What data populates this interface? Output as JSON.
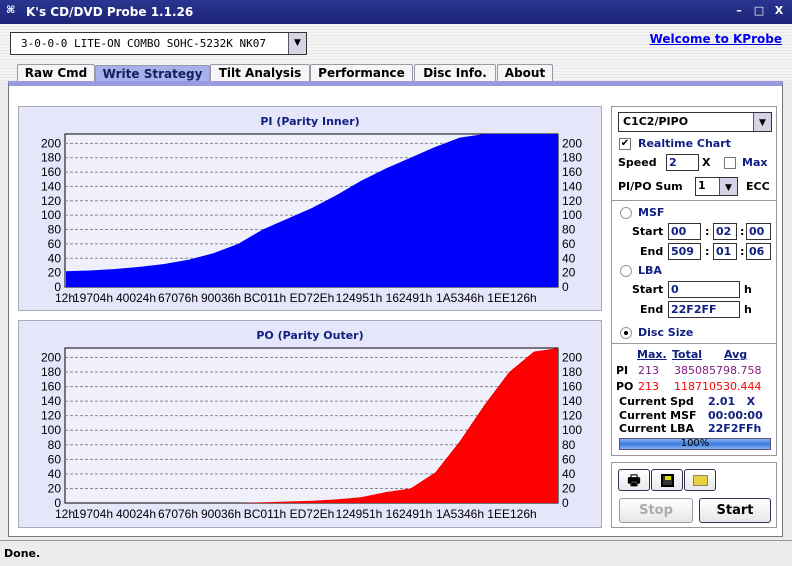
{
  "window": {
    "title": "K's CD/DVD Probe 1.1.26",
    "minimize": "–",
    "maximize": "□",
    "close": "X"
  },
  "drive": {
    "selected": "3-0-0-0 LITE-ON COMBO SOHC-5232K NK07"
  },
  "welcome_link": "Welcome to KProbe",
  "tabs": [
    {
      "label": "Raw Cmd"
    },
    {
      "label": "Write Strategy"
    },
    {
      "label": "Tilt Analysis"
    },
    {
      "label": "Performance"
    },
    {
      "label": "Disc Info."
    },
    {
      "label": "About"
    }
  ],
  "active_tab": "Write Strategy",
  "controls": {
    "mode": "C1C2/PIPO",
    "realtime_label": "Realtime Chart",
    "realtime_checked": true,
    "speed_label": "Speed",
    "speed_value": "2",
    "speed_unit": "X",
    "max_label": "Max",
    "max_checked": false,
    "sum_label": "PI/PO Sum",
    "sum_value": "1",
    "ecc_label": "ECC",
    "msf_label": "MSF",
    "start_label": "Start",
    "end_label": "End",
    "msf_start": [
      "00",
      "02",
      "00"
    ],
    "msf_end": [
      "509",
      "01",
      "06"
    ],
    "colon": ":",
    "lba_label": "LBA",
    "lba_start": "0",
    "lba_end": "22F2FF",
    "h": "h",
    "disc_size_label": "Disc Size",
    "range_mode": "Disc Size"
  },
  "stats": {
    "headers": {
      "max": "Max.",
      "total": "Total",
      "avg": "Avg"
    },
    "pi": {
      "label": "PI",
      "max": "213",
      "total": "38508579",
      "avg": "8.758"
    },
    "po": {
      "label": "PO",
      "max": "213",
      "total": "11871053",
      "avg": "0.444"
    },
    "current_spd_label": "Current Spd",
    "current_spd": "2.01   X",
    "current_msf_label": "Current MSF",
    "current_msf": "00:00:00",
    "current_lba_label": "Current LBA",
    "current_lba": "22F2FFh",
    "progress": 100,
    "progress_text": "100%"
  },
  "buttons": {
    "print": "printer-icon",
    "save": "floppy-disk-icon",
    "open": "folder-icon",
    "stop": "Stop",
    "start": "Start"
  },
  "status": "Done.",
  "colors": {
    "pi": "#0000ff",
    "po": "#ff0000",
    "titlebar": "#1b2476",
    "accent": "#102080"
  },
  "chart_data": [
    {
      "type": "bar",
      "title": "PI (Parity Inner)",
      "ylim": [
        0,
        213
      ],
      "yticks": [
        0,
        20,
        40,
        60,
        80,
        100,
        120,
        140,
        160,
        180,
        200
      ],
      "grid": true,
      "xticks": [
        "12h",
        "19704h",
        "40024h",
        "67076h",
        "90036h",
        "BC011h",
        "ED72Eh",
        "124951h",
        "162491h",
        "1A5346h",
        "1EE126h"
      ],
      "x_fraction": [
        0,
        0.05,
        0.1,
        0.15,
        0.2,
        0.25,
        0.3,
        0.35,
        0.4,
        0.45,
        0.5,
        0.55,
        0.6,
        0.65,
        0.7,
        0.75,
        0.8,
        0.85,
        0.9,
        0.95,
        1
      ],
      "values": [
        22,
        23,
        25,
        28,
        32,
        38,
        47,
        60,
        80,
        95,
        110,
        128,
        148,
        165,
        180,
        195,
        208,
        213,
        213,
        213,
        213
      ],
      "color": "#0000ff"
    },
    {
      "type": "bar",
      "title": "PO (Parity Outer)",
      "ylim": [
        0,
        213
      ],
      "yticks": [
        0,
        20,
        40,
        60,
        80,
        100,
        120,
        140,
        160,
        180,
        200
      ],
      "grid": true,
      "xticks": [
        "12h",
        "19704h",
        "40024h",
        "67076h",
        "90036h",
        "BC011h",
        "ED72Eh",
        "124951h",
        "162491h",
        "1A5346h",
        "1EE126h"
      ],
      "x_fraction": [
        0,
        0.05,
        0.1,
        0.15,
        0.2,
        0.25,
        0.3,
        0.35,
        0.4,
        0.45,
        0.5,
        0.55,
        0.6,
        0.65,
        0.7,
        0.75,
        0.8,
        0.85,
        0.9,
        0.95,
        1
      ],
      "values": [
        0,
        0,
        0,
        0,
        0,
        0,
        0,
        0,
        1,
        2,
        3,
        5,
        8,
        15,
        20,
        42,
        85,
        135,
        180,
        208,
        213
      ],
      "color": "#ff0000"
    }
  ]
}
